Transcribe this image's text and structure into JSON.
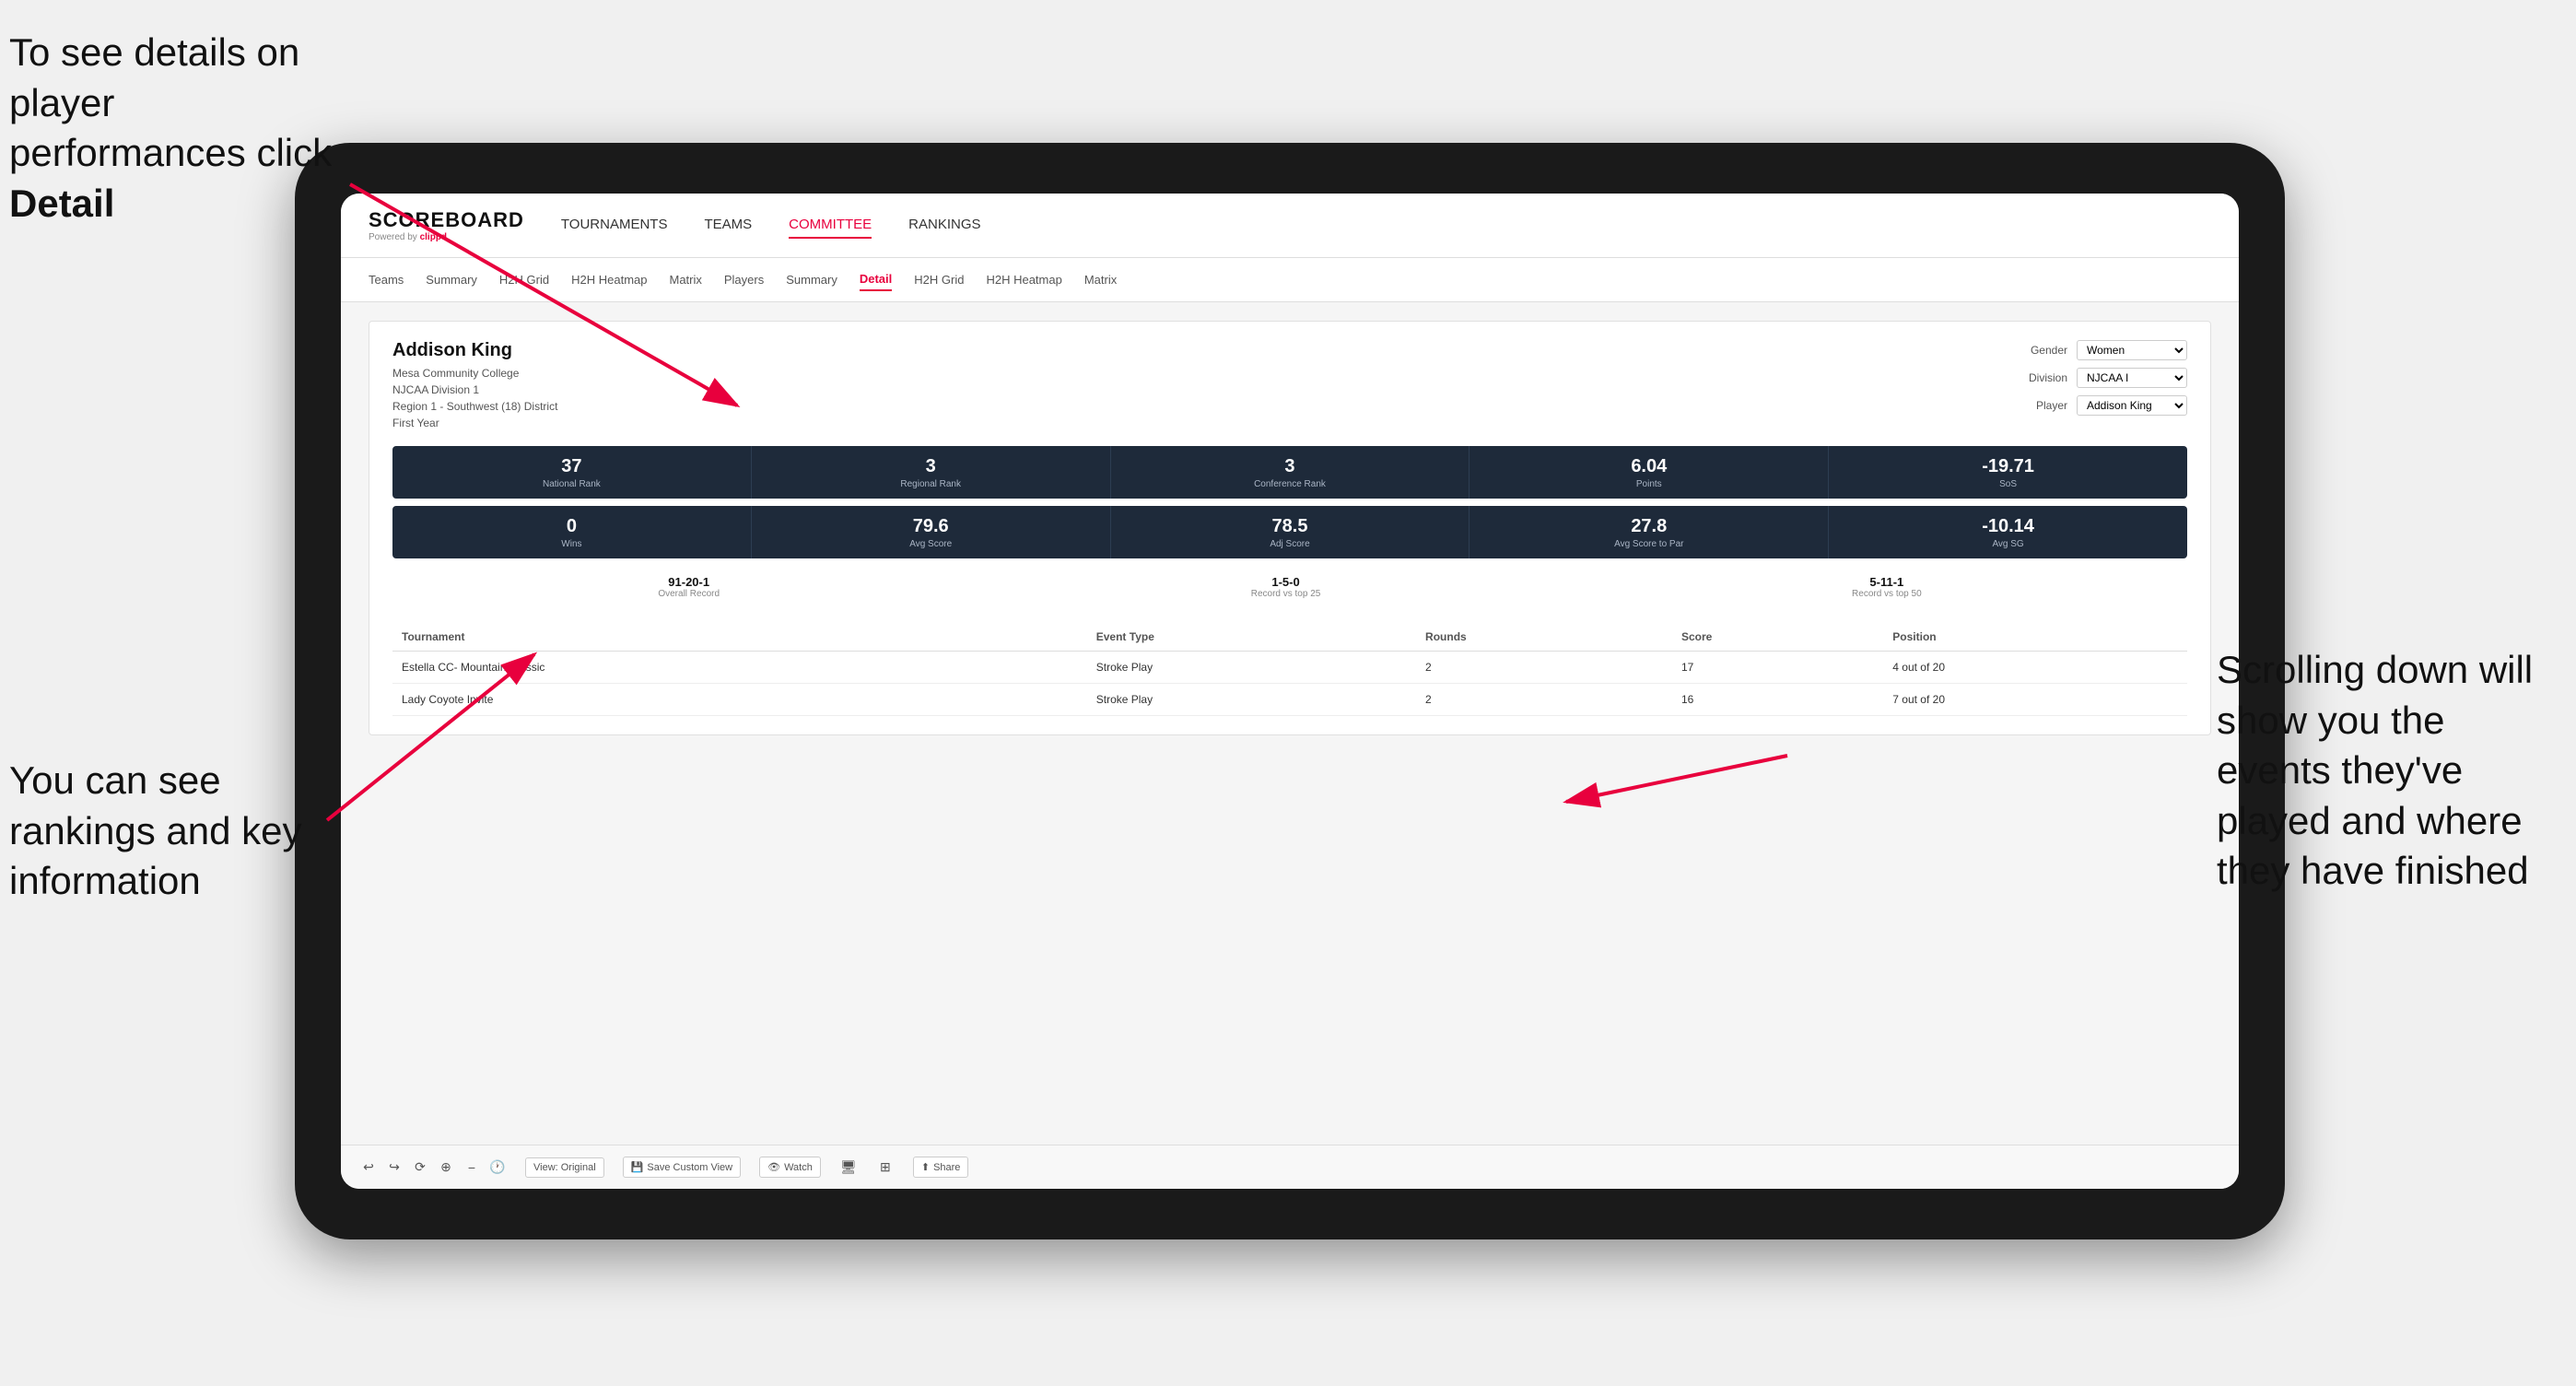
{
  "annotations": {
    "top_left": "To see details on player performances click Detail",
    "bottom_left": "You can see rankings and key information",
    "right": "Scrolling down will show you the events they've played and where they have finished"
  },
  "nav": {
    "logo": "SCOREBOARD",
    "powered_by": "Powered by",
    "clippd": "clippd",
    "items": [
      {
        "label": "TOURNAMENTS",
        "active": false
      },
      {
        "label": "TEAMS",
        "active": false
      },
      {
        "label": "COMMITTEE",
        "active": true
      },
      {
        "label": "RANKINGS",
        "active": false
      }
    ]
  },
  "sub_nav": {
    "items": [
      {
        "label": "Teams",
        "active": false
      },
      {
        "label": "Summary",
        "active": false
      },
      {
        "label": "H2H Grid",
        "active": false
      },
      {
        "label": "H2H Heatmap",
        "active": false
      },
      {
        "label": "Matrix",
        "active": false
      },
      {
        "label": "Players",
        "active": false
      },
      {
        "label": "Summary",
        "active": false
      },
      {
        "label": "Detail",
        "active": true
      },
      {
        "label": "H2H Grid",
        "active": false
      },
      {
        "label": "H2H Heatmap",
        "active": false
      },
      {
        "label": "Matrix",
        "active": false
      }
    ]
  },
  "player": {
    "name": "Addison King",
    "college": "Mesa Community College",
    "division": "NJCAA Division 1",
    "region": "Region 1 - Southwest (18) District",
    "year": "First Year"
  },
  "filters": {
    "gender_label": "Gender",
    "gender_value": "Women",
    "division_label": "Division",
    "division_value": "NJCAA I",
    "player_label": "Player",
    "player_value": "Addison King"
  },
  "stats_row1": [
    {
      "value": "37",
      "label": "National Rank"
    },
    {
      "value": "3",
      "label": "Regional Rank"
    },
    {
      "value": "3",
      "label": "Conference Rank"
    },
    {
      "value": "6.04",
      "label": "Points"
    },
    {
      "value": "-19.71",
      "label": "SoS"
    }
  ],
  "stats_row2": [
    {
      "value": "0",
      "label": "Wins"
    },
    {
      "value": "79.6",
      "label": "Avg Score"
    },
    {
      "value": "78.5",
      "label": "Adj Score"
    },
    {
      "value": "27.8",
      "label": "Avg Score to Par"
    },
    {
      "value": "-10.14",
      "label": "Avg SG"
    }
  ],
  "records": [
    {
      "value": "91-20-1",
      "label": "Overall Record"
    },
    {
      "value": "1-5-0",
      "label": "Record vs top 25"
    },
    {
      "value": "5-11-1",
      "label": "Record vs top 50"
    }
  ],
  "tournament_table": {
    "headers": [
      "Tournament",
      "Event Type",
      "Rounds",
      "Score",
      "Position"
    ],
    "rows": [
      {
        "tournament": "Estella CC- Mountain Classic",
        "event_type": "Stroke Play",
        "rounds": "2",
        "score": "17",
        "position": "4 out of 20"
      },
      {
        "tournament": "Lady Coyote Invite",
        "event_type": "Stroke Play",
        "rounds": "2",
        "score": "16",
        "position": "7 out of 20"
      }
    ]
  },
  "toolbar": {
    "view_original": "View: Original",
    "save_custom": "Save Custom View",
    "watch": "Watch",
    "share": "Share"
  }
}
